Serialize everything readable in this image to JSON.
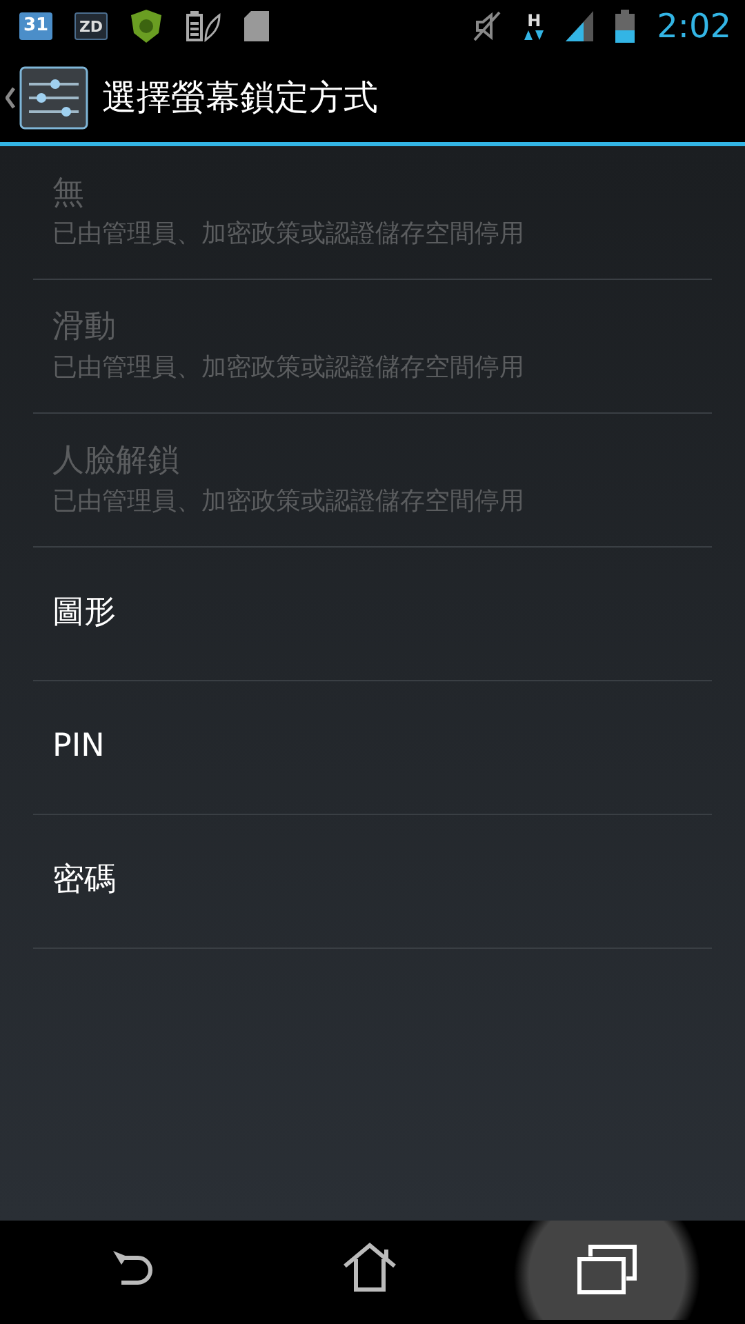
{
  "status_bar": {
    "notifications": [
      {
        "kind": "calendar",
        "text": "31"
      },
      {
        "kind": "app",
        "text": "ZD"
      },
      {
        "kind": "shield"
      },
      {
        "kind": "battery-saver"
      },
      {
        "kind": "sd-card"
      }
    ],
    "network": "H",
    "time": "2:02"
  },
  "action_bar": {
    "title": "選擇螢幕鎖定方式"
  },
  "items": [
    {
      "title": "無",
      "summary": "已由管理員、加密政策或認證儲存空間停用",
      "disabled": true
    },
    {
      "title": "滑動",
      "summary": "已由管理員、加密政策或認證儲存空間停用",
      "disabled": true
    },
    {
      "title": "人臉解鎖",
      "summary": "已由管理員、加密政策或認證儲存空間停用",
      "disabled": true
    },
    {
      "title": "圖形",
      "disabled": false
    },
    {
      "title": "PIN",
      "disabled": false
    },
    {
      "title": "密碼",
      "disabled": false
    }
  ],
  "nav_bar": [
    {
      "kind": "back",
      "pressed": false
    },
    {
      "kind": "home",
      "pressed": false
    },
    {
      "kind": "recents",
      "pressed": true
    }
  ]
}
